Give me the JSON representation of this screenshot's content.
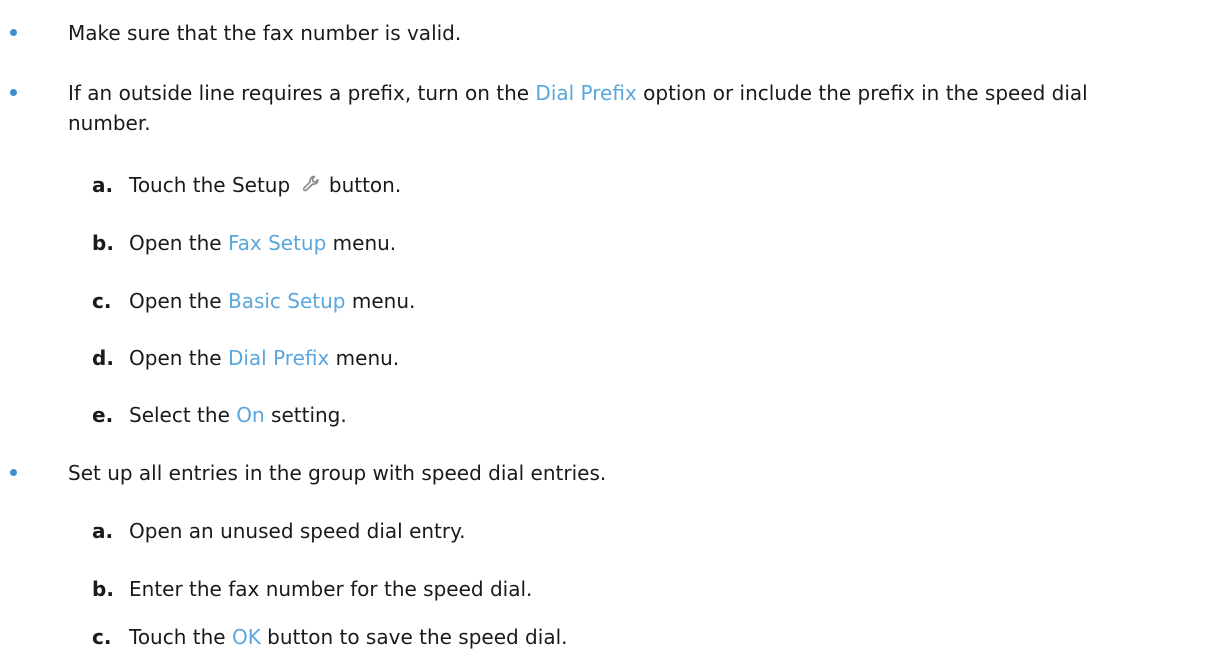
{
  "colors": {
    "bullet": "#3a8fd0",
    "highlight": "#5aa7dd",
    "text": "#1a1a1a"
  },
  "bullet1": {
    "text": "Make sure that the fax number is valid."
  },
  "bullet2": {
    "text_before": "If an outside line requires a prefix, turn on the ",
    "highlight": "Dial Prefix",
    "text_after": " option or include the prefix in the speed dial number.",
    "steps": [
      {
        "letter": "a.",
        "before": "Touch the Setup",
        "icon": "wrench-icon",
        "after": "button."
      },
      {
        "letter": "b.",
        "before": "Open the ",
        "highlight": "Fax Setup",
        "after": " menu."
      },
      {
        "letter": "c.",
        "before": "Open the ",
        "highlight": "Basic Setup",
        "after": " menu."
      },
      {
        "letter": "d.",
        "before": "Open the ",
        "highlight": "Dial Prefix",
        "after": " menu."
      },
      {
        "letter": "e.",
        "before": "Select the ",
        "highlight": "On",
        "after": " setting."
      }
    ]
  },
  "bullet3": {
    "text": "Set up all entries in the group with speed dial entries.",
    "steps": [
      {
        "letter": "a.",
        "text": "Open an unused speed dial entry."
      },
      {
        "letter": "b.",
        "text": "Enter the fax number for the speed dial."
      },
      {
        "letter": "c.",
        "before": "Touch the ",
        "highlight": "OK",
        "after": " button to save the speed dial."
      }
    ]
  }
}
